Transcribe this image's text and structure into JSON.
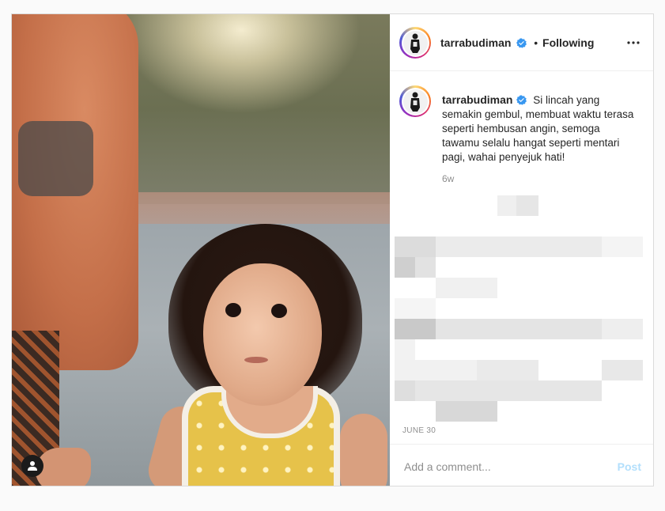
{
  "post": {
    "username": "tarrabudiman",
    "verified": true,
    "follow_status": "Following",
    "more_icon": "more-horizontal-icon"
  },
  "caption": {
    "username": "tarrabudiman",
    "text": "Si lincah yang semakin gembul, membuat waktu terasa seperti hembusan angin, semoga tawamu selalu hangat seperti mentari pagi, wahai penyejuk hati!",
    "time_ago": "6w"
  },
  "meta": {
    "date": "JUNE 30"
  },
  "comment_box": {
    "placeholder": "Add a comment...",
    "post_label": "Post"
  },
  "colors": {
    "verified_blue": "#3897f0",
    "post_disabled": "#b2dffc",
    "muted_text": "#8e8e8e",
    "border": "#dbdbdb"
  }
}
